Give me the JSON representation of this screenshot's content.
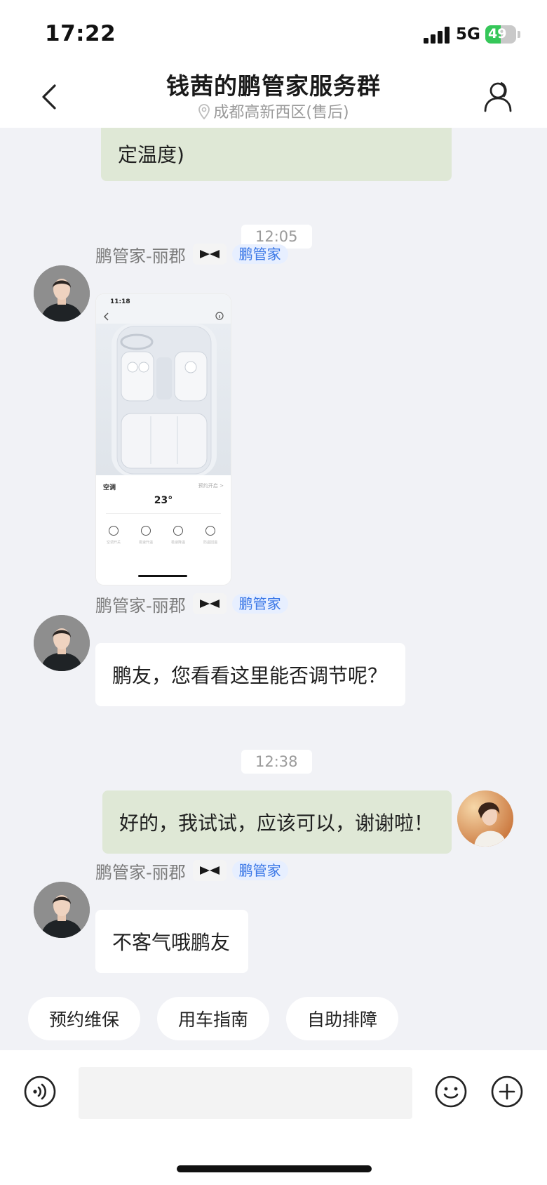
{
  "status_bar": {
    "time": "17:22",
    "network": "5G",
    "battery": "49",
    "battery_fraction": 0.49
  },
  "header": {
    "title": "钱茜的鹏管家服务群",
    "subtitle": "成都高新西区(售后)"
  },
  "messages": [
    {
      "type": "bubble_partial",
      "text": "定温度)"
    },
    {
      "type": "time",
      "text": "12:05"
    },
    {
      "type": "agent_image",
      "sender": "鹏管家-丽郡",
      "badge": "鹏管家",
      "image": {
        "status_time": "11:18",
        "panel_title": "空调",
        "panel_link": "预约开启 >",
        "temperature": "23°",
        "controls": [
          "空调开关",
          "极速升温",
          "极速降温",
          "防盗回温"
        ]
      }
    },
    {
      "type": "agent_text",
      "sender": "鹏管家-丽郡",
      "badge": "鹏管家",
      "text": "鹏友，您看看这里能否调节呢？"
    },
    {
      "type": "time",
      "text": "12:38"
    },
    {
      "type": "user_text",
      "text": "好的，我试试，应该可以，谢谢啦！"
    },
    {
      "type": "agent_text",
      "sender": "鹏管家-丽郡",
      "badge": "鹏管家",
      "text": "不客气哦鹏友"
    }
  ],
  "quick_actions": [
    "预约维保",
    "用车指南",
    "自助排障"
  ],
  "colors": {
    "my_bubble": "#dfe8d6",
    "badge_text": "#3b78e7",
    "badge_bg": "#e7efff",
    "background": "#f1f2f6"
  },
  "icons": [
    "back-arrow-icon",
    "group-member-icon",
    "location-pin-icon",
    "xpeng-logo-icon",
    "voice-icon",
    "emoji-icon",
    "plus-icon"
  ]
}
